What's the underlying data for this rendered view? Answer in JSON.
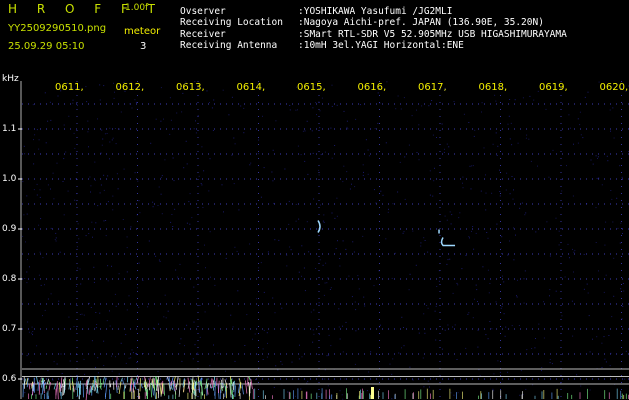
{
  "header": {
    "app_title": "H R O F F T",
    "version": "1.00f",
    "filename": "YY2509290510.png",
    "datetime": "25.09.29 05:10",
    "meteor_label": "meteor",
    "meteor_count": "3"
  },
  "station": [
    {
      "key": "Ovserver",
      "value": ":YOSHIKAWA Yasufumi /JG2MLI"
    },
    {
      "key": "Receiving Location",
      "value": ":Nagoya Aichi-pref. JAPAN (136.90E, 35.20N)"
    },
    {
      "key": "Receiver",
      "value": ":SMart RTL-SDR V5 52.905MHz USB HIGASHIMURAYAMA"
    },
    {
      "key": "Receiving Antenna",
      "value": ":10mH 3el.YAGI Horizontal:ENE"
    }
  ],
  "spectrogram": {
    "y_unit": "kHz",
    "y_ticks": [
      "1.1",
      "1.0",
      "0.9",
      "0.8",
      "0.7",
      "0.6"
    ],
    "y_values": [
      1.1,
      1.0,
      0.9,
      0.8,
      0.7,
      0.6
    ],
    "time_ticks": [
      "0611",
      "0612",
      "0613",
      "0614",
      "0615",
      "0616",
      "0617",
      "0618",
      "0619",
      "0620"
    ],
    "ylim": [
      0.58,
      1.17
    ],
    "background_color": "#000000",
    "grid_color": "#5858ff",
    "trace_color": "#9fd9ff",
    "meteor_echoes": [
      {
        "time_min": 4.0,
        "freq_khz": 0.905
      },
      {
        "time_min": 6.05,
        "freq_khz": 0.875
      }
    ]
  }
}
